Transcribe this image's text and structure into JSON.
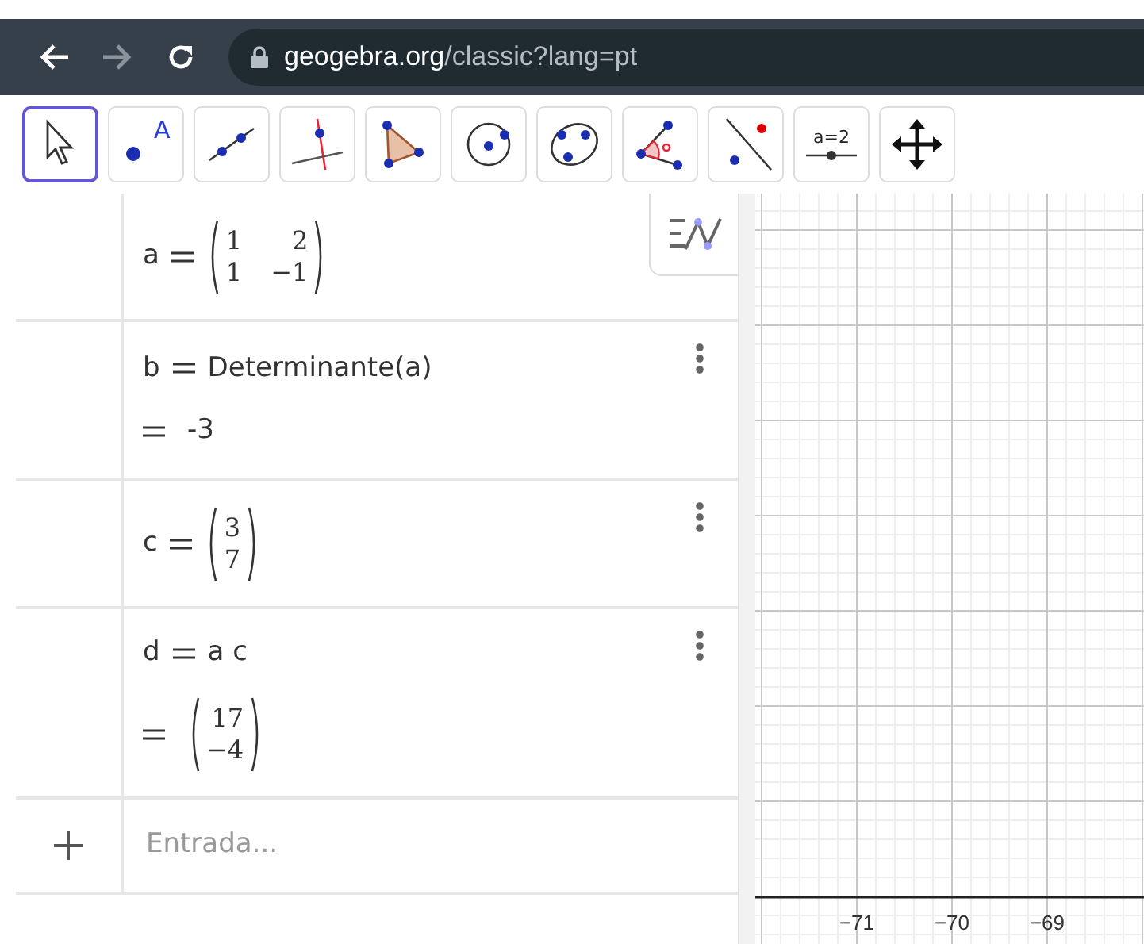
{
  "browser": {
    "url_host": "geogebra.org",
    "url_path": "/classic?lang=pt"
  },
  "toolbar": {
    "tools": [
      {
        "kind": "move",
        "selected": true
      },
      {
        "kind": "point",
        "selected": false,
        "label": "A"
      },
      {
        "kind": "line",
        "selected": false
      },
      {
        "kind": "perpendicular",
        "selected": false
      },
      {
        "kind": "polygon",
        "selected": false
      },
      {
        "kind": "circle",
        "selected": false
      },
      {
        "kind": "ellipse",
        "selected": false
      },
      {
        "kind": "angle",
        "selected": false
      },
      {
        "kind": "reflect",
        "selected": false
      },
      {
        "kind": "slider",
        "selected": false,
        "label": "a=2"
      },
      {
        "kind": "pan",
        "selected": false
      }
    ]
  },
  "algebra": {
    "items": [
      {
        "label": "a",
        "definition": {
          "kind": "matrix",
          "rows": [
            [
              "1",
              "2"
            ],
            [
              "1",
              "−1"
            ]
          ]
        }
      },
      {
        "label": "b",
        "definition": {
          "kind": "text",
          "text": "Determinante(a)"
        },
        "result": {
          "kind": "text",
          "text": "-3"
        },
        "menu": true
      },
      {
        "label": "c",
        "definition": {
          "kind": "matrix",
          "rows": [
            [
              "3"
            ],
            [
              "7"
            ]
          ]
        },
        "menu": true
      },
      {
        "label": "d",
        "definition": {
          "kind": "text",
          "text": "a c"
        },
        "result": {
          "kind": "matrix",
          "rows": [
            [
              "17"
            ],
            [
              "−4"
            ]
          ]
        },
        "menu": true
      }
    ],
    "input": {
      "placeholder": "Entrada..."
    }
  },
  "graphics": {
    "x_axis_labels": [
      "−71",
      "−70",
      "−69"
    ]
  }
}
